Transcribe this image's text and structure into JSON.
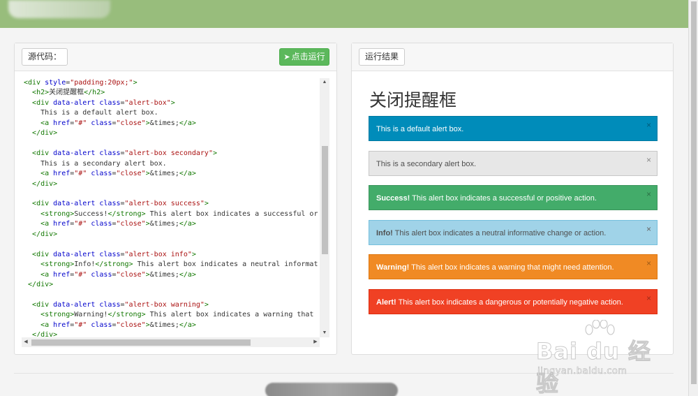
{
  "header": {},
  "editor": {
    "source_label": "源代码：",
    "run_label": "点击运行",
    "code_lines": [
      [
        [
          "t",
          "<div "
        ],
        [
          "a",
          "style"
        ],
        [
          "x",
          "="
        ],
        [
          "s",
          "\"padding:20px;\""
        ],
        [
          "t",
          ">"
        ]
      ],
      [
        [
          "x",
          "  "
        ],
        [
          "t",
          "<h2>"
        ],
        [
          "x",
          "关闭提醒框"
        ],
        [
          "t",
          "</h2>"
        ]
      ],
      [
        [
          "x",
          "  "
        ],
        [
          "t",
          "<div "
        ],
        [
          "a",
          "data-alert "
        ],
        [
          "a",
          "class"
        ],
        [
          "x",
          "="
        ],
        [
          "s",
          "\"alert-box\""
        ],
        [
          "t",
          ">"
        ]
      ],
      [
        [
          "x",
          "    This is a default alert box."
        ]
      ],
      [
        [
          "x",
          "    "
        ],
        [
          "t",
          "<a "
        ],
        [
          "a",
          "href"
        ],
        [
          "x",
          "="
        ],
        [
          "s",
          "\"#\" "
        ],
        [
          "a",
          "class"
        ],
        [
          "x",
          "="
        ],
        [
          "s",
          "\"close\""
        ],
        [
          "t",
          ">"
        ],
        [
          "x",
          "&times;"
        ],
        [
          "t",
          "</a>"
        ]
      ],
      [
        [
          "x",
          "  "
        ],
        [
          "t",
          "</div>"
        ]
      ],
      [
        [
          "x",
          ""
        ]
      ],
      [
        [
          "x",
          "  "
        ],
        [
          "t",
          "<div "
        ],
        [
          "a",
          "data-alert "
        ],
        [
          "a",
          "class"
        ],
        [
          "x",
          "="
        ],
        [
          "s",
          "\"alert-box secondary\""
        ],
        [
          "t",
          ">"
        ]
      ],
      [
        [
          "x",
          "    This is a secondary alert box."
        ]
      ],
      [
        [
          "x",
          "    "
        ],
        [
          "t",
          "<a "
        ],
        [
          "a",
          "href"
        ],
        [
          "x",
          "="
        ],
        [
          "s",
          "\"#\" "
        ],
        [
          "a",
          "class"
        ],
        [
          "x",
          "="
        ],
        [
          "s",
          "\"close\""
        ],
        [
          "t",
          ">"
        ],
        [
          "x",
          "&times;"
        ],
        [
          "t",
          "</a>"
        ]
      ],
      [
        [
          "x",
          "  "
        ],
        [
          "t",
          "</div>"
        ]
      ],
      [
        [
          "x",
          ""
        ]
      ],
      [
        [
          "x",
          "  "
        ],
        [
          "t",
          "<div "
        ],
        [
          "a",
          "data-alert "
        ],
        [
          "a",
          "class"
        ],
        [
          "x",
          "="
        ],
        [
          "s",
          "\"alert-box success\""
        ],
        [
          "t",
          ">"
        ]
      ],
      [
        [
          "x",
          "    "
        ],
        [
          "t",
          "<strong>"
        ],
        [
          "x",
          "Success!"
        ],
        [
          "t",
          "</strong>"
        ],
        [
          "x",
          " This alert box indicates a successful or positi"
        ]
      ],
      [
        [
          "x",
          "    "
        ],
        [
          "t",
          "<a "
        ],
        [
          "a",
          "href"
        ],
        [
          "x",
          "="
        ],
        [
          "s",
          "\"#\" "
        ],
        [
          "a",
          "class"
        ],
        [
          "x",
          "="
        ],
        [
          "s",
          "\"close\""
        ],
        [
          "t",
          ">"
        ],
        [
          "x",
          "&times;"
        ],
        [
          "t",
          "</a>"
        ]
      ],
      [
        [
          "x",
          "  "
        ],
        [
          "t",
          "</div>"
        ]
      ],
      [
        [
          "x",
          ""
        ]
      ],
      [
        [
          "x",
          "  "
        ],
        [
          "t",
          "<div "
        ],
        [
          "a",
          "data-alert "
        ],
        [
          "a",
          "class"
        ],
        [
          "x",
          "="
        ],
        [
          "s",
          "\"alert-box info\""
        ],
        [
          "t",
          ">"
        ]
      ],
      [
        [
          "x",
          "    "
        ],
        [
          "t",
          "<strong>"
        ],
        [
          "x",
          "Info!"
        ],
        [
          "t",
          "</strong>"
        ],
        [
          "x",
          " This alert box indicates a neutral informative ch"
        ]
      ],
      [
        [
          "x",
          "    "
        ],
        [
          "t",
          "<a "
        ],
        [
          "a",
          "href"
        ],
        [
          "x",
          "="
        ],
        [
          "s",
          "\"#\" "
        ],
        [
          "a",
          "class"
        ],
        [
          "x",
          "="
        ],
        [
          "s",
          "\"close\""
        ],
        [
          "t",
          ">"
        ],
        [
          "x",
          "&times;"
        ],
        [
          "t",
          "</a>"
        ]
      ],
      [
        [
          "x",
          " "
        ],
        [
          "t",
          "</div>"
        ]
      ],
      [
        [
          "x",
          ""
        ]
      ],
      [
        [
          "x",
          "  "
        ],
        [
          "t",
          "<div "
        ],
        [
          "a",
          "data-alert "
        ],
        [
          "a",
          "class"
        ],
        [
          "x",
          "="
        ],
        [
          "s",
          "\"alert-box warning\""
        ],
        [
          "t",
          ">"
        ]
      ],
      [
        [
          "x",
          "    "
        ],
        [
          "t",
          "<strong>"
        ],
        [
          "x",
          "Warning!"
        ],
        [
          "t",
          "</strong>"
        ],
        [
          "x",
          " This alert box indicates a warning that might"
        ]
      ],
      [
        [
          "x",
          "    "
        ],
        [
          "t",
          "<a "
        ],
        [
          "a",
          "href"
        ],
        [
          "x",
          "="
        ],
        [
          "s",
          "\"#\" "
        ],
        [
          "a",
          "class"
        ],
        [
          "x",
          "="
        ],
        [
          "s",
          "\"close\""
        ],
        [
          "t",
          ">"
        ],
        [
          "x",
          "&times;"
        ],
        [
          "t",
          "</a>"
        ]
      ],
      [
        [
          "x",
          "  "
        ],
        [
          "t",
          "</div>"
        ]
      ]
    ]
  },
  "result": {
    "label": "运行结果",
    "heading": "关闭提醒框",
    "alerts": [
      {
        "strong": "",
        "text": "This is a default alert box.",
        "close": "×"
      },
      {
        "strong": "",
        "text": "This is a secondary alert box.",
        "close": "×"
      },
      {
        "strong": "Success!",
        "text": " This alert box indicates a successful or positive action.",
        "close": "×"
      },
      {
        "strong": "Info!",
        "text": " This alert box indicates a neutral informative change or action.",
        "close": "×"
      },
      {
        "strong": "Warning!",
        "text": " This alert box indicates a warning that might need attention.",
        "close": "×"
      },
      {
        "strong": "Alert!",
        "text": " This alert box indicates a dangerous or potentially negative action.",
        "close": "×"
      }
    ]
  },
  "watermark": {
    "brand": "Bai  du 经验",
    "url": "jingyan.baidu.com"
  },
  "colors": {
    "topbar": "#98bd7c",
    "run_button": "#5cb85c",
    "alert_default": "#008cba",
    "alert_secondary": "#e7e7e7",
    "alert_success": "#43ac6a",
    "alert_info": "#a0d3e8",
    "alert_warning": "#f08a24",
    "alert_danger": "#f04124"
  }
}
